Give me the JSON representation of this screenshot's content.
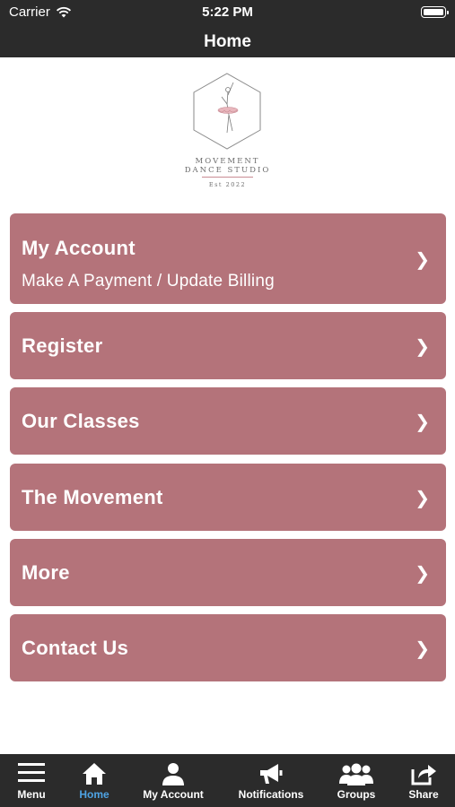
{
  "status_bar": {
    "carrier": "Carrier",
    "time": "5:22 PM"
  },
  "nav": {
    "title": "Home"
  },
  "logo": {
    "line1": "MOVEMENT",
    "line2": "DANCE STUDIO",
    "line3": "Est 2022"
  },
  "menu": [
    {
      "label": "My Account",
      "sub": "Make A Payment / Update Billing"
    },
    {
      "label": "Register"
    },
    {
      "label": "Our Classes"
    },
    {
      "label": "The Movement"
    },
    {
      "label": "More"
    },
    {
      "label": "Contact Us"
    }
  ],
  "chevron": "❯",
  "tabs": [
    {
      "label": "Menu",
      "icon": "hamburger-icon"
    },
    {
      "label": "Home",
      "icon": "home-icon",
      "active": true
    },
    {
      "label": "My Account",
      "icon": "person-icon"
    },
    {
      "label": "Notifications",
      "icon": "megaphone-icon"
    },
    {
      "label": "Groups",
      "icon": "group-icon"
    },
    {
      "label": "Share",
      "icon": "share-icon"
    }
  ],
  "colors": {
    "bar": "#2b2b2b",
    "tile": "#b4737a",
    "active_tab": "#4ea3e4"
  }
}
